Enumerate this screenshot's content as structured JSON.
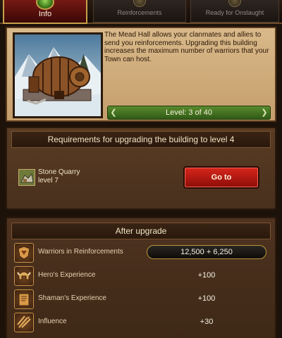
{
  "tabs": [
    {
      "label": "Info",
      "icon": "info-icon"
    },
    {
      "label": "Reinforcements",
      "icon": "reinforcements-icon"
    },
    {
      "label": "Ready for Onslaught",
      "icon": "onslaught-icon"
    }
  ],
  "building": {
    "image": "mead-hall-building",
    "description": "The Mead Hall allows your clanmates and allies to send you reinforcements. Upgrading this building increases the maximum number of warriors that your Town can host.",
    "level_text": "Level: 3 of 40"
  },
  "requirements": {
    "title": "Requirements for upgrading the building to level 4",
    "item_icon": "stone-quarry-icon",
    "item_name": "Stone Quarry",
    "item_level": "level 7",
    "goto_label": "Go to"
  },
  "after_upgrade": {
    "title": "After upgrade",
    "stats": [
      {
        "icon": "warriors-icon",
        "label": "Warriors in Reinforcements",
        "value": "12,500 + 6,250"
      },
      {
        "icon": "hero-helmet-icon",
        "label": "Hero's Experience",
        "value": "+100"
      },
      {
        "icon": "shaman-book-icon",
        "label": "Shaman's Experience",
        "value": "+100"
      },
      {
        "icon": "influence-icon",
        "label": "Influence",
        "value": "+30"
      }
    ]
  },
  "colors": {
    "accent_gold": "#c8a04a",
    "button_red": "#c41e16",
    "level_green": "#4a7a24"
  }
}
